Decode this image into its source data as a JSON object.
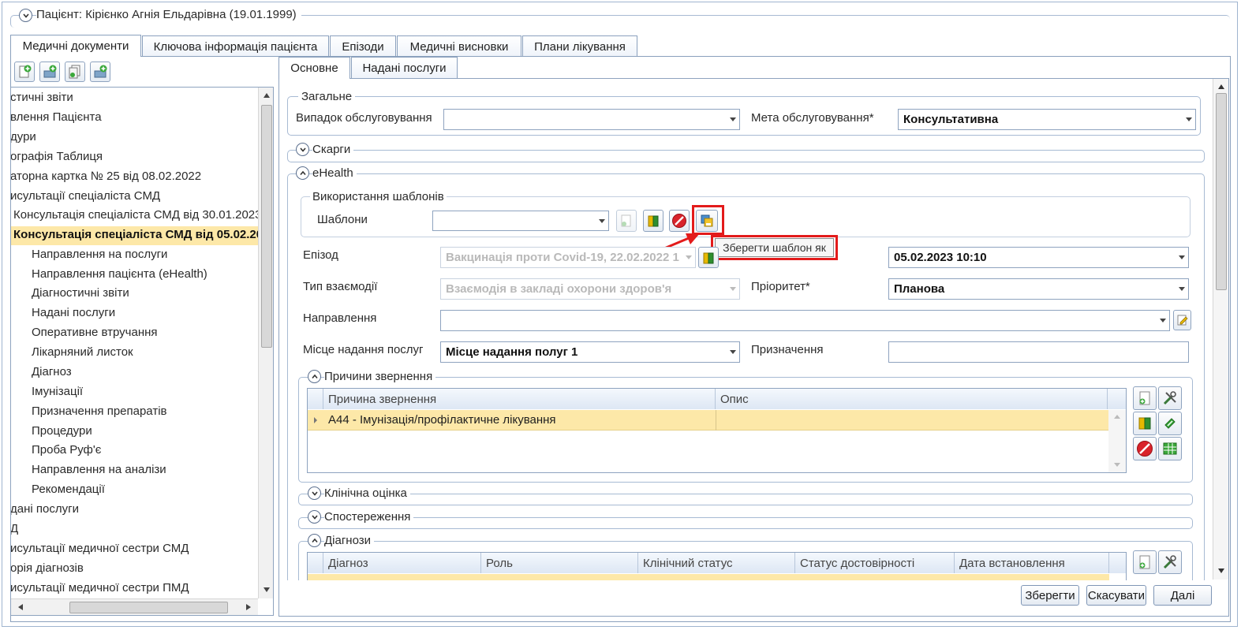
{
  "patient": {
    "title": "Пацієнт: Кірієнко Агнія Ельдарівна (19.01.1999)"
  },
  "main_tabs": [
    {
      "label": "Медичні документи"
    },
    {
      "label": "Ключова інформація пацієнта"
    },
    {
      "label": "Епізоди"
    },
    {
      "label": "Медичні висновки"
    },
    {
      "label": "Плани лікування"
    }
  ],
  "sub_tabs": [
    {
      "label": "Основне"
    },
    {
      "label": "Надані послуги"
    }
  ],
  "tree": {
    "items": [
      "стичні звіти",
      "влення Пацієнта",
      "дури",
      "ографія Таблиця",
      "аторна картка № 25 від 08.02.2022",
      "исультації спеціаліста СМД",
      "Консультація спеціаліста СМД від 30.01.2023",
      "Консультація спеціаліста СМД від 05.02.20",
      "Направлення на послуги",
      "Направлення пацієнта (eHealth)",
      "Діагностичні звіти",
      "Надані послуги",
      "Оперативне втручання",
      "Лікарняний листок",
      "Діагноз",
      "Імунізації",
      "Призначення препаратів",
      "Процедури",
      "Проба Руф'є",
      "Направлення на аналізи",
      "Рекомендації",
      "дані послуги",
      "Д",
      "исультації медичної сестри СМД",
      "орія діагнозів",
      "исультації медичної сестри ПМД"
    ]
  },
  "general": {
    "legend": "Загальне",
    "case_label": "Випадок обслуговування",
    "case_value": "",
    "purpose_label": "Мета обслуговування*",
    "purpose_value": "Консультативна"
  },
  "complaints": {
    "legend": "Скарги"
  },
  "ehealth": {
    "legend": "eHealth",
    "templates_legend": "Використання шаблонів",
    "templates_label": "Шаблони",
    "templates_value": "",
    "tooltip": "Зберегти шаблон як",
    "episode_label": "Епізод",
    "episode_value": "Вакцинація проти Covid-19, 22.02.2022 1",
    "date_value": "05.02.2023 10:10",
    "interaction_label": "Тип взаємодії",
    "interaction_value": "Взаємодія в закладі охорони здоров'я",
    "priority_label": "Пріоритет*",
    "priority_value": "Планова",
    "referral_label": "Направлення",
    "referral_value": "",
    "place_label": "Місце надання послуг",
    "place_value": "Місце надання полуг 1",
    "assign_label": "Призначення",
    "assign_value": ""
  },
  "reasons": {
    "legend": "Причини звернення",
    "headers": [
      "Причина звернення",
      "Опис"
    ],
    "rows": [
      {
        "reason": "A44 - Імунізація/профілактичне лікування",
        "desc": ""
      }
    ]
  },
  "clinical": {
    "legend": "Клінічна оцінка"
  },
  "observations": {
    "legend": "Спостереження"
  },
  "diagnoses": {
    "legend": "Діагнози",
    "headers": [
      "Діагноз",
      "Роль",
      "Клінічний статус",
      "Статус достовірності",
      "Дата встановлення"
    ]
  },
  "footer": {
    "save": "Зберегти",
    "cancel": "Скасувати",
    "next": "Далі"
  },
  "colors": {
    "highlight_box": "#e31b1b",
    "selected_row": "#fde8a8",
    "border": "#8ea3bf"
  }
}
